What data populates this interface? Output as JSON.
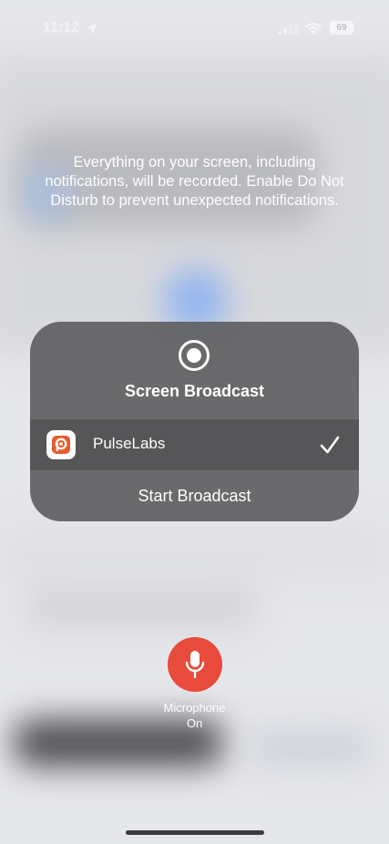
{
  "status_bar": {
    "time": "11:12",
    "battery": "69"
  },
  "warning": {
    "text": "Everything on your screen, including notifications, will be recorded. Enable Do Not Disturb to prevent unexpected notifications."
  },
  "broadcast_panel": {
    "title": "Screen Broadcast",
    "app_name": "PulseLabs",
    "app_selected": true,
    "start_label": "Start Broadcast"
  },
  "microphone": {
    "label": "Microphone",
    "state": "On",
    "color": "#e84a3c"
  },
  "icons": {
    "record": "record-icon",
    "app": "pulselabs-app-icon",
    "check": "checkmark-icon",
    "mic": "microphone-icon",
    "location": "location-arrow-icon",
    "wifi": "wifi-icon",
    "signal": "cellular-signal-icon",
    "battery": "battery-icon"
  },
  "colors": {
    "panel_bg": "#606062",
    "app_accent": "#e85a2c",
    "mic_red": "#e84a3c"
  }
}
